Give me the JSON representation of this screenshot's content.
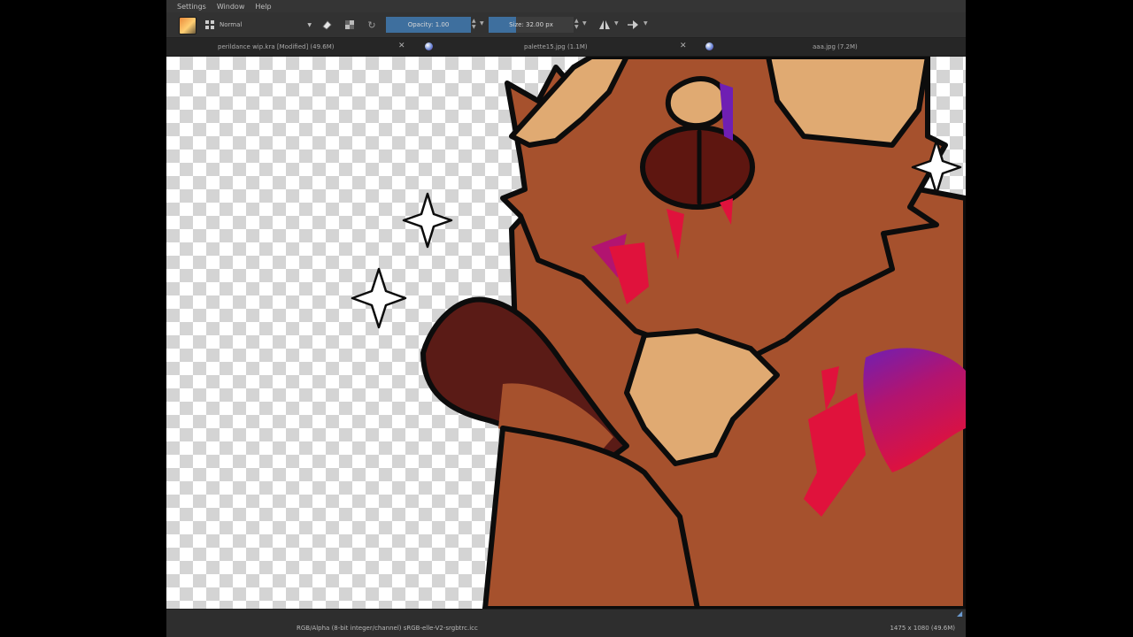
{
  "menu": {
    "items": [
      "Settings",
      "Window",
      "Help"
    ]
  },
  "toolbar": {
    "blend_mode": "Normal",
    "opacity_label": "Opacity:  1.00",
    "opacity_value": 1.0,
    "size_label": "Size:  32.00 px",
    "size_fraction": 0.32
  },
  "tabs": [
    {
      "title": "perildance wip.kra [Modified]  (49.6M)"
    },
    {
      "title": "palette15.jpg (1.1M)"
    },
    {
      "title": "aaa.jpg (7.2M)"
    }
  ],
  "status": {
    "color_info": "RGB/Alpha (8-bit integer/channel)  sRGB-elle-V2-srgbtrc.icc",
    "image_info": "1475 x 1080 (49.6M)"
  },
  "colors": {
    "fur": "#a6512d",
    "fur_light": "#e0aa72",
    "paw_dark": "#5a1b16",
    "eye": "#5e1610",
    "accent_red": "#e0123c",
    "accent_purple": "#6f1fb3",
    "outline": "#0c0c0c",
    "slider_fill": "#3e6f9e"
  },
  "icons": [
    "brush-preset-icon",
    "grid-icon",
    "eraser-icon",
    "alpha-lock-icon",
    "reset-icon",
    "mirror-icon",
    "wrap-icon"
  ]
}
